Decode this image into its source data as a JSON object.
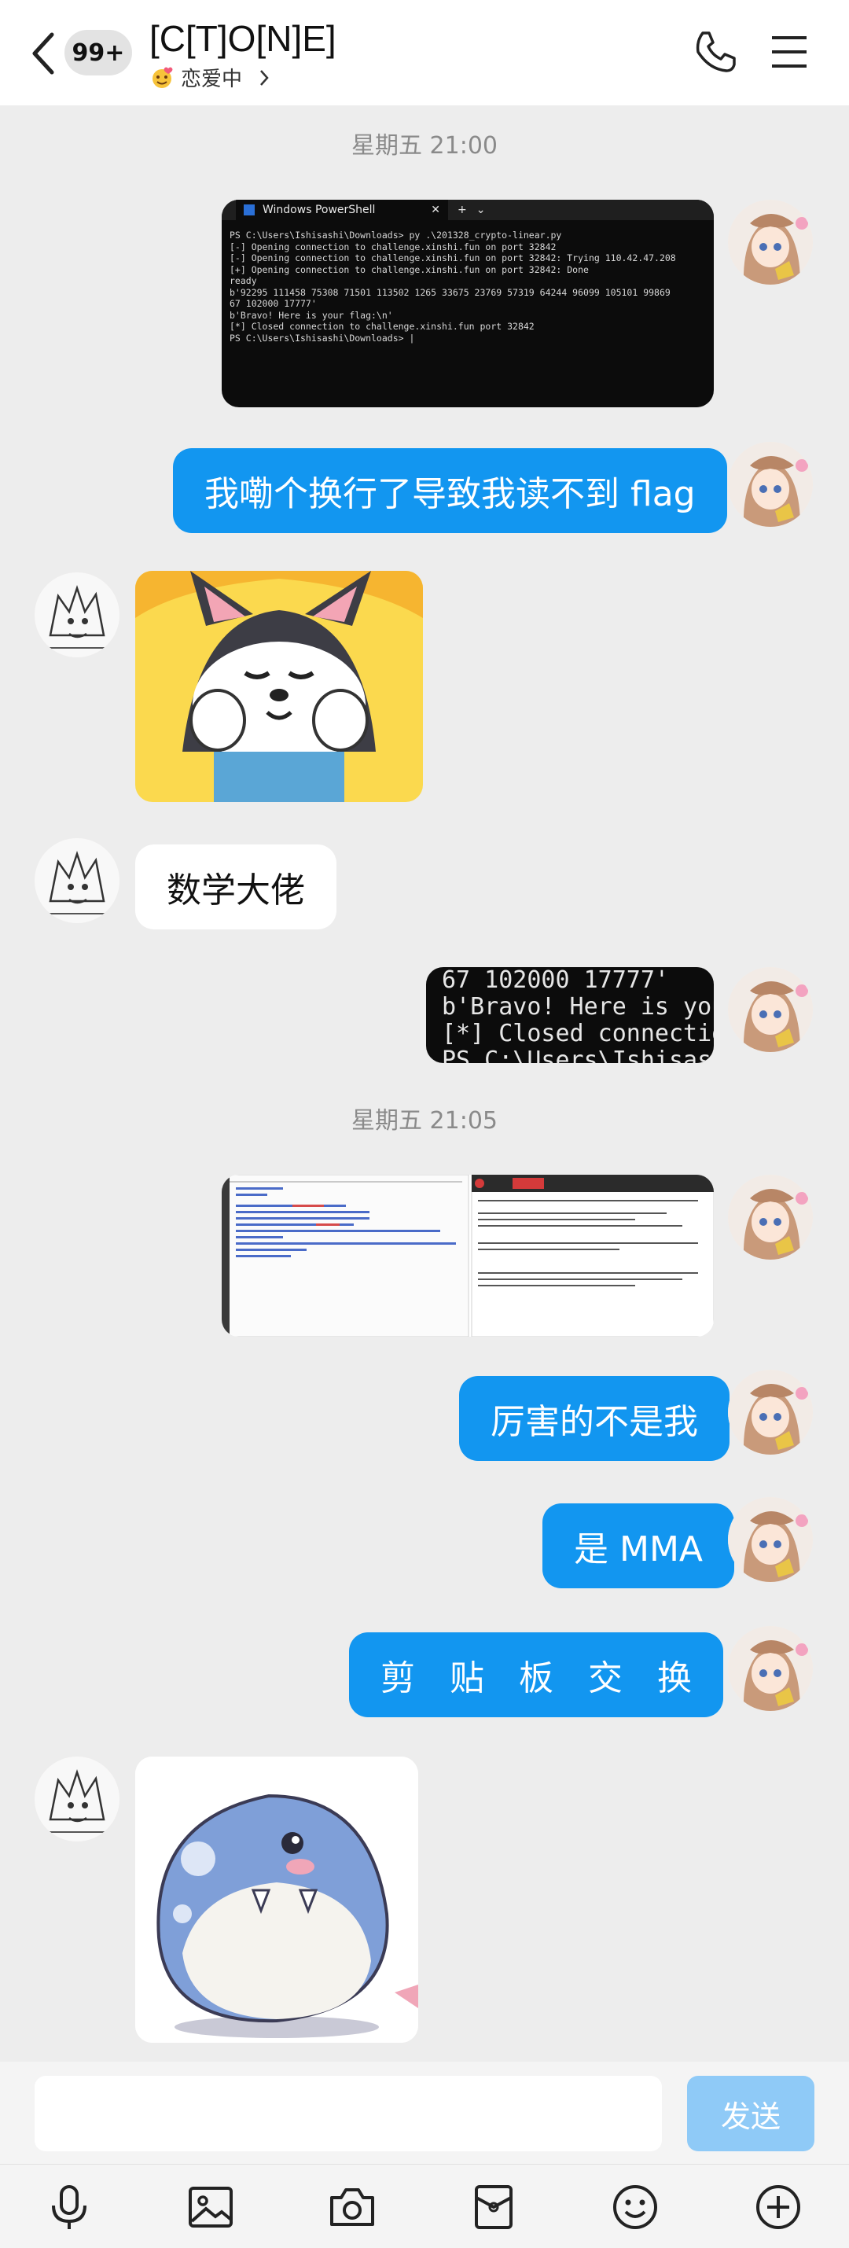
{
  "header": {
    "unread_count": "99+",
    "title": "[C[T]O[N]E]",
    "status": "恋爱中"
  },
  "messages": {
    "timestamp_1": "星期五 21:00",
    "msg_text_1": "我嘞个换行了导致我读不到 flag",
    "msg_text_2": "数学大佬",
    "timestamp_2": "星期五 21:05",
    "msg_text_3": "厉害的不是我",
    "msg_text_4": "是 MMA",
    "msg_text_5": "剪　贴　板　交　换"
  },
  "powershell": {
    "tab_title": "Windows PowerShell",
    "lines": [
      "PS C:\\Users\\Ishisashi\\Downloads> py .\\201328_crypto-linear.py",
      "[-] Opening connection to challenge.xinshi.fun on port 32842",
      "[-] Opening connection to challenge.xinshi.fun on port 32842: Trying 110.42.47.208",
      "[+] Opening connection to challenge.xinshi.fun on port 32842: Done",
      "ready",
      "b'92295 111458 75308 71501 113502 1265 33675 23769 57319 64244 96099 105101 99869",
      "67 102000 17777'",
      "b'Bravo! Here is your flag:\\n'",
      "[*] Closed connection to challenge.xinshi.fun port 32842",
      "PS C:\\Users\\Ishisashi\\Downloads> |"
    ]
  },
  "zoomed_terminal": {
    "lines": [
      "67 102000 17777'",
      "b'Bravo! Here is you",
      "[*] Closed connectio",
      "PS C:\\Users\\Ishisash"
    ]
  },
  "input": {
    "placeholder": "",
    "send_label": "发送"
  },
  "colors": {
    "accent": "#1296f0",
    "send_disabled": "#8fcaf7",
    "background": "#ededed"
  },
  "toolbar_icons": [
    "microphone-icon",
    "image-icon",
    "camera-icon",
    "red-packet-icon",
    "emoji-icon",
    "plus-icon"
  ]
}
